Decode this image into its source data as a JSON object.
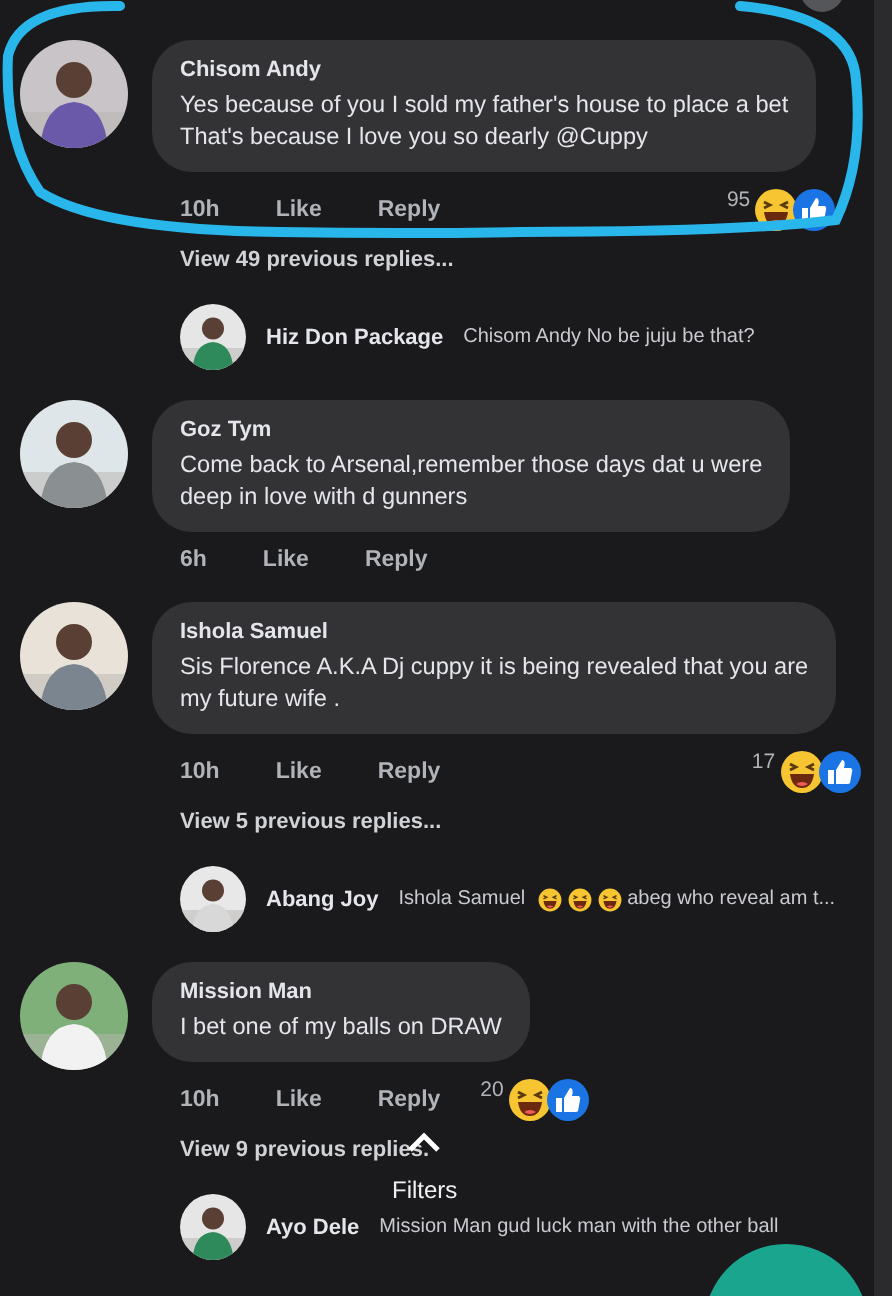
{
  "comments": [
    {
      "name": "Chisom Andy",
      "text": "Yes because of you I sold my father's house to place a bet\nThat's because I love you so dearly @Cuppy",
      "time": "10h",
      "like": "Like",
      "reply": "Reply",
      "reaction_count": "95",
      "highlighted": true,
      "view_replies": "View 49 previous replies...",
      "reply_preview": {
        "name": "Hiz Don Package",
        "segments": [
          {
            "kind": "text",
            "text": "Chisom Andy No be juju be that?"
          }
        ]
      }
    },
    {
      "name": "Goz Tym",
      "text": "Come back to Arsenal,remember those days dat u were\ndeep in love with d gunners",
      "time": "6h",
      "like": "Like",
      "reply": "Reply",
      "highlighted": false
    },
    {
      "name": "Ishola Samuel",
      "text": "Sis Florence A.K.A Dj cuppy it is being revealed that you are\nmy future wife .",
      "time": "10h",
      "like": "Like",
      "reply": "Reply",
      "reaction_count": "17",
      "highlighted": false,
      "view_replies": "View 5 previous replies...",
      "reply_preview": {
        "name": "Abang Joy",
        "segments": [
          {
            "kind": "text",
            "text": "Ishola Samuel"
          },
          {
            "kind": "emoji"
          },
          {
            "kind": "emoji"
          },
          {
            "kind": "emoji"
          },
          {
            "kind": "text",
            "text": "abeg who reveal am t..."
          }
        ]
      }
    },
    {
      "name": "Mission Man",
      "text": "I bet one of my balls on DRAW",
      "time": "10h",
      "like": "Like",
      "reply": "Reply",
      "reaction_count": "20",
      "highlighted": false,
      "view_replies": "View 9 previous replies.",
      "reply_preview": {
        "name": "Ayo Dele",
        "segments": [
          {
            "kind": "text",
            "text": "Mission Man gud luck man with the other ball"
          }
        ]
      }
    }
  ],
  "filters": {
    "label": "Filters"
  }
}
